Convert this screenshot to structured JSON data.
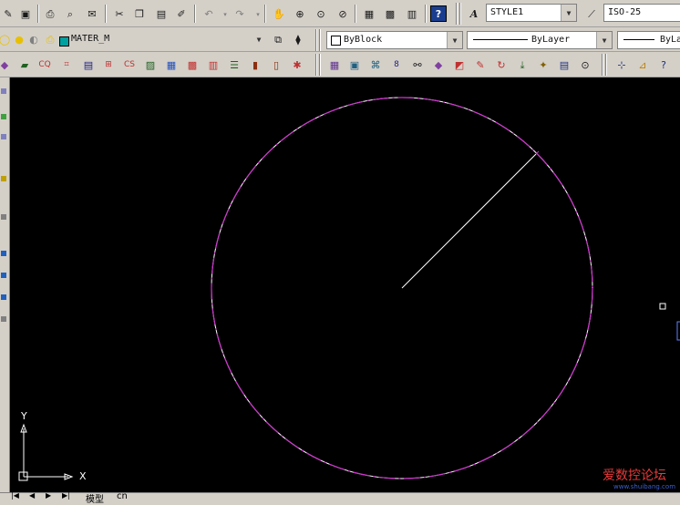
{
  "toolbar_top": {
    "text_style_value": "STYLE1",
    "dim_style_value": "ISO-25"
  },
  "toolbar_layers": {
    "layer_value": "MATER_M",
    "color_value": "ByBlock",
    "linetype_value": "ByLayer",
    "lineweight_value": "ByLa"
  },
  "canvas": {
    "background": "#000000",
    "circle_color": "#cc33cc",
    "line_color": "#ffffff",
    "ucs_x_label": "X",
    "ucs_y_label": "Y"
  },
  "tabs": {
    "model_label": "模型",
    "layout_label": "cn"
  },
  "watermark": {
    "text": "爱数控论坛",
    "url": "www.shuibang.com"
  }
}
